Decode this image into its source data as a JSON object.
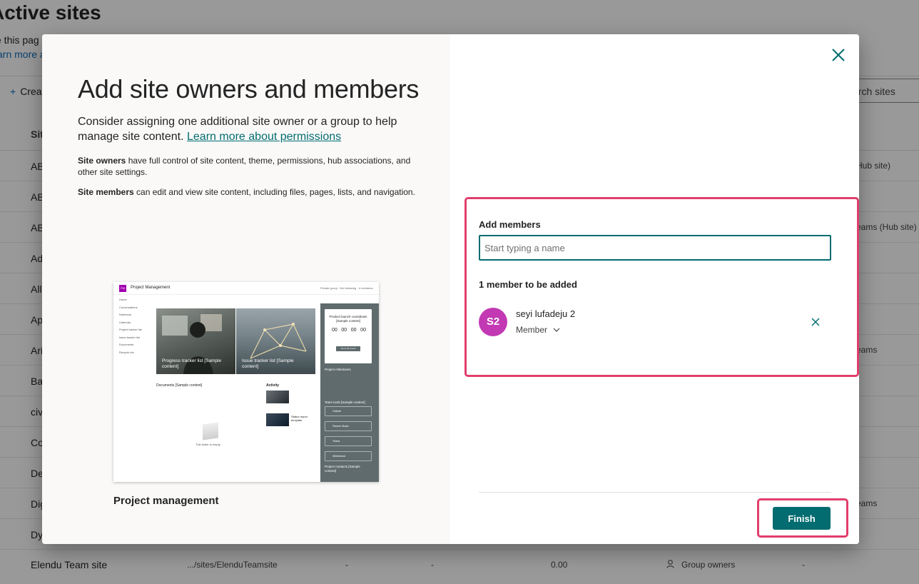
{
  "background": {
    "title": "Active sites",
    "description": "e this pag",
    "learn_more": "arn more a",
    "create": "Create",
    "search": "arch sites",
    "column_header": "Sit",
    "rows": [
      {
        "name": "AB",
        "right": "Hub site)"
      },
      {
        "name": "AB",
        "right": ""
      },
      {
        "name": "AB",
        "right": "eams (Hub site)"
      },
      {
        "name": "Ad",
        "right": ""
      },
      {
        "name": "All",
        "right": ""
      },
      {
        "name": "Ap",
        "right": ""
      },
      {
        "name": "Ari",
        "right": "eams"
      },
      {
        "name": "Ba",
        "right": ""
      },
      {
        "name": "civ",
        "right": ""
      },
      {
        "name": "Co",
        "right": ""
      },
      {
        "name": "De",
        "right": ""
      },
      {
        "name": "Dig",
        "right": "eams"
      },
      {
        "name": "Dy",
        "right": ""
      }
    ],
    "last_row": {
      "name": "Elendu Team site",
      "url": ".../sites/ElenduTeamsite",
      "col3": "-",
      "col4": "-",
      "storage": "0.00",
      "owners": "Group owners",
      "col7": "-"
    }
  },
  "dialog": {
    "title": "Add site owners and members",
    "subtitle": "Consider assigning one additional site owner or a group to help manage site content.",
    "subtitle_link": "Learn more about permissions",
    "owners_bold": "Site owners",
    "owners_text": " have full control of site content, theme, permissions, hub associations, and other site settings.",
    "members_bold": "Site members",
    "members_text": " can edit and view site content, including files, pages, lists, and navigation.",
    "preview": {
      "site_name": "Project Management",
      "logo": "PM",
      "meta": "Private group · Not following · 4 members",
      "nav": [
        "Home",
        "Conversations",
        "Notebook",
        "Calendar",
        "Project tracker list",
        "Issue tracker list",
        "Documents",
        "Recycle bin"
      ],
      "hero1": "Progress tracker list [Sample content]",
      "hero2": "Issue tracker list [Sample content]",
      "countdown_title": "Product launch countdown [Sample content]",
      "countdown_values": [
        "00",
        "00",
        "00",
        "00"
      ],
      "countdown_button": "Go to the event",
      "milestones": "Project milestones",
      "team_tools": "Team tools [Sample content]",
      "tools": [
        "OnNote",
        "Planner Studio",
        "Teams",
        "Whiteboard"
      ],
      "contacts": "Project contacts [Sample content]",
      "documents": "Documents [Sample content]",
      "activity": "Activity",
      "activity_item": "Status report template",
      "empty": "This folder is empty."
    },
    "template_name": "Project management",
    "add_members_label": "Add members",
    "input_placeholder": "Start typing a name",
    "count_label": "1 member to be added",
    "member": {
      "initials": "S2",
      "name": "seyi lufadeju 2",
      "role": "Member",
      "avatar_color": "#c239b3"
    },
    "finish_label": "Finish"
  },
  "colors": {
    "accent": "#036c70",
    "highlight": "#e23e6b"
  }
}
